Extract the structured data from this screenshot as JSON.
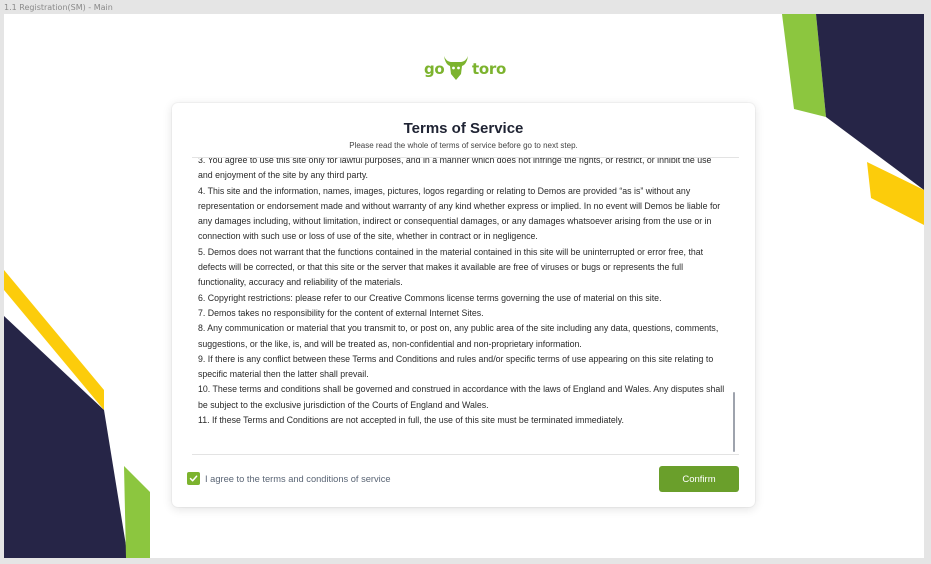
{
  "window": {
    "title": "1.1 Registration(SM) - Main"
  },
  "brand": {
    "logo_left": "go",
    "logo_right": "toro",
    "logo_icon": "bull-head-icon",
    "accent_color": "#7cb32e",
    "navy_color": "#262547",
    "yellow_color": "#fccc0b"
  },
  "dialog": {
    "title": "Terms of Service",
    "subtitle": "Please read the whole of terms of service before go to next step.",
    "terms": [
      "3. You agree to use this site only for lawful purposes, and in a manner which does not infringe the rights, or restrict, or inhibit the use and enjoyment of the site by any third party.",
      "4. This site and the information, names, images, pictures, logos regarding or relating to Demos are provided “as is” without any representation or endorsement made and without warranty of any kind whether express or implied. In no event will Demos be liable for any damages including, without limitation, indirect or consequential damages, or any damages whatsoever arising from the use or in connection with such use or loss of use of the site, whether in contract or in negligence.",
      "5. Demos does not warrant that the functions contained in the material contained in this site will be uninterrupted or error free, that defects will be corrected, or that this site or the server that makes it available are free of viruses or bugs or represents the full functionality, accuracy and reliability of the materials.",
      "6. Copyright restrictions: please refer to our Creative Commons license terms governing the use of material on this site.",
      "7. Demos takes no responsibility for the content of external Internet Sites.",
      "8. Any communication or material that you transmit to, or post on, any public area of the site including any data, questions, comments, suggestions, or the like, is, and will be treated as, non-confidential and non-proprietary information.",
      "9. If there is any conflict between these Terms and Conditions and rules and/or specific terms of use appearing on this site relating to specific material then the latter shall prevail.",
      "10. These terms and conditions shall be governed and construed in accordance with the laws of England and Wales. Any disputes shall be subject to the exclusive jurisdiction of the Courts of England and Wales.",
      "11. If these Terms and Conditions are not accepted in full, the use of this site must be terminated immediately."
    ],
    "agree_label": "I agree to the terms and conditions of service",
    "agree_checked": true,
    "confirm_label": "Confirm"
  }
}
